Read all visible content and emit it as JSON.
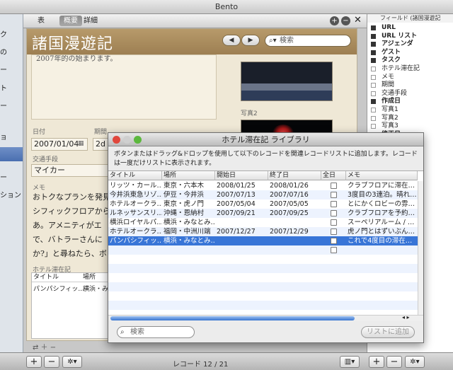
{
  "window": {
    "title": "Bento"
  },
  "sidebar": {
    "items": [
      "ク",
      "の",
      "ー",
      "ト",
      "ー",
      "ョ",
      "ー",
      "ション"
    ]
  },
  "toolbar": {
    "tabs": [
      "表",
      "概要",
      "詳細"
    ],
    "active_tab": "概要"
  },
  "form": {
    "title": "諸国漫遊記",
    "search_placeholder": "検索",
    "note_text": "2007年的の始まります。",
    "date_label": "日付",
    "date_value": "2007/01/04",
    "period_label": "期間",
    "period_value": "2d",
    "transport_label": "交通手段",
    "transport_value": "マイカー",
    "memo_label": "メモ",
    "memo_lines": [
      "おトクなプランを発見",
      "シフィックフロアから",
      "あ。アメニティがエ",
      "で、バトラーさんに",
      "か?」と尋ねたら、ボ"
    ],
    "photo2_label": "写真2",
    "portal_label": "ホテル滞在記",
    "portal_headers": [
      "タイトル",
      "場所"
    ],
    "portal_row": [
      "パンパシフィッ…",
      "横浜・み"
    ]
  },
  "fields_panel": {
    "header": "フィールド (諸国漫遊記",
    "items": [
      {
        "name": "URL",
        "checked": true,
        "bold": true
      },
      {
        "name": "URL リスト",
        "checked": true,
        "bold": true
      },
      {
        "name": "アジェンダ",
        "checked": true,
        "bold": true
      },
      {
        "name": "ゲスト",
        "checked": true,
        "bold": true
      },
      {
        "name": "タスク",
        "checked": true,
        "bold": true
      },
      {
        "name": "ホテル滞在記",
        "checked": false,
        "bold": false
      },
      {
        "name": "メモ",
        "checked": false,
        "bold": false
      },
      {
        "name": "期間",
        "checked": false,
        "bold": false
      },
      {
        "name": "交通手段",
        "checked": false,
        "bold": false
      },
      {
        "name": "作成日",
        "checked": true,
        "bold": true
      },
      {
        "name": "写真1",
        "checked": false,
        "bold": false
      },
      {
        "name": "写真2",
        "checked": false,
        "bold": false
      },
      {
        "name": "写真3",
        "checked": false,
        "bold": false
      },
      {
        "name": "修正日",
        "checked": true,
        "bold": true
      }
    ]
  },
  "dialog": {
    "title": "ホテル滞在記 ライブラリ",
    "message": "ボタンまたはドラッグ&ドロップを使用して以下のレコードを関連レコードリストに追加します。レコードは一度だけリストに表示されます。",
    "columns": [
      "タイトル",
      "場所",
      "開始日",
      "終了日",
      "全日",
      "メモ"
    ],
    "rows": [
      [
        "リッツ・カール…",
        "東京・六本木",
        "2008/01/25",
        "2008/01/26",
        "",
        "クラブフロアに滞在…"
      ],
      [
        "今井浜東急リゾ…",
        "伊豆・今井浜",
        "2007/07/13",
        "2007/07/16",
        "",
        "3度目の3連泊。晴れ…"
      ],
      [
        "ホテルオークラ…",
        "東京・虎ノ門",
        "2007/05/04",
        "2007/05/05",
        "",
        "とにかくロビーの雰…"
      ],
      [
        "ルネッサンスリ…",
        "沖縄・恩納村",
        "2007/09/21",
        "2007/09/25",
        "",
        "クラブフロアを予約…"
      ],
      [
        "横浜ロイヤルパ…",
        "横浜・みなとみ…",
        "",
        "",
        "",
        "スーペリアルーム / …"
      ],
      [
        "ホテルオークラ…",
        "福岡・中洲川端",
        "2007/12/27",
        "2007/12/29",
        "",
        "虎ノ門とはずいぶん…"
      ],
      [
        "パンパシフィッ…",
        "横浜・みなとみ…",
        "",
        "",
        "",
        "これで4度目の滞在…"
      ]
    ],
    "selected_row": 6,
    "search_placeholder": "検索",
    "add_button": "リストに追加"
  },
  "bottom": {
    "record_count": "レコード 12 / 21"
  }
}
